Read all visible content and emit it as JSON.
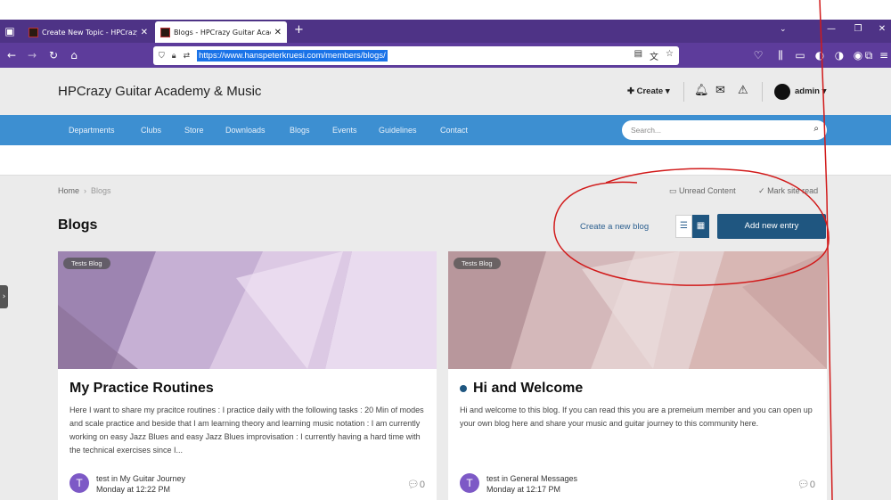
{
  "browser": {
    "tabs": [
      {
        "title": "Create New Topic - HPCrazy Gu",
        "active": false
      },
      {
        "title": "Blogs - HPCrazy Guitar Academ",
        "active": true
      }
    ],
    "new_tab_icon": "plus-icon",
    "url": "https://www.hanspeterkruesi.com/members/blogs/"
  },
  "site": {
    "title": "HPCrazy Guitar Academy & Music",
    "create_label": "Create",
    "user_label": "admin",
    "nav_items": [
      "Departments",
      "Clubs",
      "Store",
      "Downloads",
      "Blogs",
      "Events",
      "Guidelines",
      "Contact"
    ],
    "search_placeholder": "Search..."
  },
  "page": {
    "breadcrumb": [
      "Home",
      "Blogs"
    ],
    "unread_content": "Unread Content",
    "mark_site_read": "Mark site read",
    "title": "Blogs",
    "create_blog": "Create a new blog",
    "add_entry": "Add new entry"
  },
  "cards": [
    {
      "category": "Tests Blog",
      "title": "My Practice Routines",
      "unread": false,
      "excerpt": "Here I want to share my pracitce routines : I practice daily with the following tasks : 20 Min of modes and scale practice and beside that I am learning theory and learning music notation : I am currently working on easy Jazz Blues and easy Jazz Blues improvisation : I currently having a hard time with the technical exercises since I...",
      "author_initial": "T",
      "author_line": "test in My Guitar Journey",
      "date": "Monday at 12:22 PM",
      "comments": "0"
    },
    {
      "category": "Tests Blog",
      "title": "Hi and Welcome",
      "unread": true,
      "excerpt": "Hi and welcome to this blog. If you can read this you are a premeium member and you can open up your own blog here and share your music and guitar journey to this community here.",
      "author_initial": "T",
      "author_line": "test in General Messages",
      "date": "Monday at 12:17 PM",
      "comments": "0"
    }
  ],
  "colors": {
    "tabbar": "#4e3386",
    "navbar": "#5d3c9b",
    "site_nav": "#3d8fd1",
    "primary_button": "#1f5680",
    "annotation": "#d11a1a"
  }
}
